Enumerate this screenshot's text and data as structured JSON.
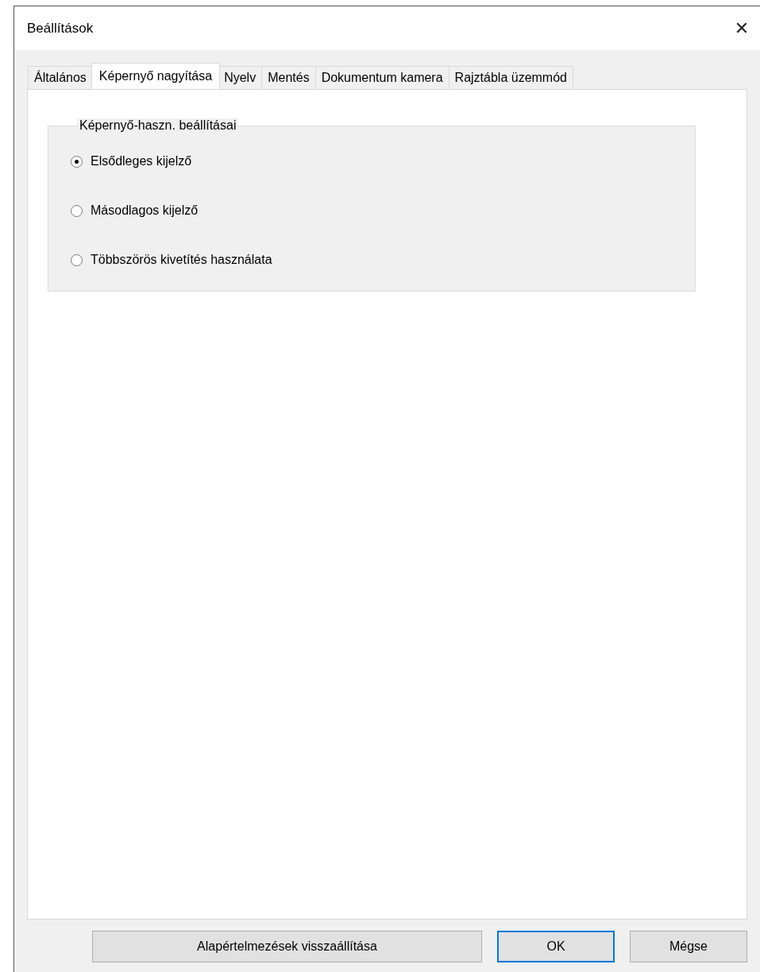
{
  "window": {
    "title": "Beállítások",
    "close": "✕"
  },
  "tabs": [
    {
      "label": "Általános",
      "selected": false
    },
    {
      "label": "Képernyő nagyítása",
      "selected": true
    },
    {
      "label": "Nyelv",
      "selected": false
    },
    {
      "label": "Mentés",
      "selected": false
    },
    {
      "label": "Dokumentum kamera",
      "selected": false
    },
    {
      "label": "Rajztábla üzemmód",
      "selected": false
    }
  ],
  "group": {
    "title": "Képernyő-haszn. beállításai",
    "options": [
      {
        "label": "Elsődleges kijelző",
        "selected": true
      },
      {
        "label": "Másodlagos kijelző",
        "selected": false
      },
      {
        "label": "Többszörös kivetítés használata",
        "selected": false
      }
    ]
  },
  "buttons": [
    {
      "label": "Alapértelmezések visszaállítása",
      "kind": "wide",
      "default": false
    },
    {
      "label": "OK",
      "kind": "normal",
      "default": true
    },
    {
      "label": "Mégse",
      "kind": "normal",
      "default": false
    }
  ]
}
